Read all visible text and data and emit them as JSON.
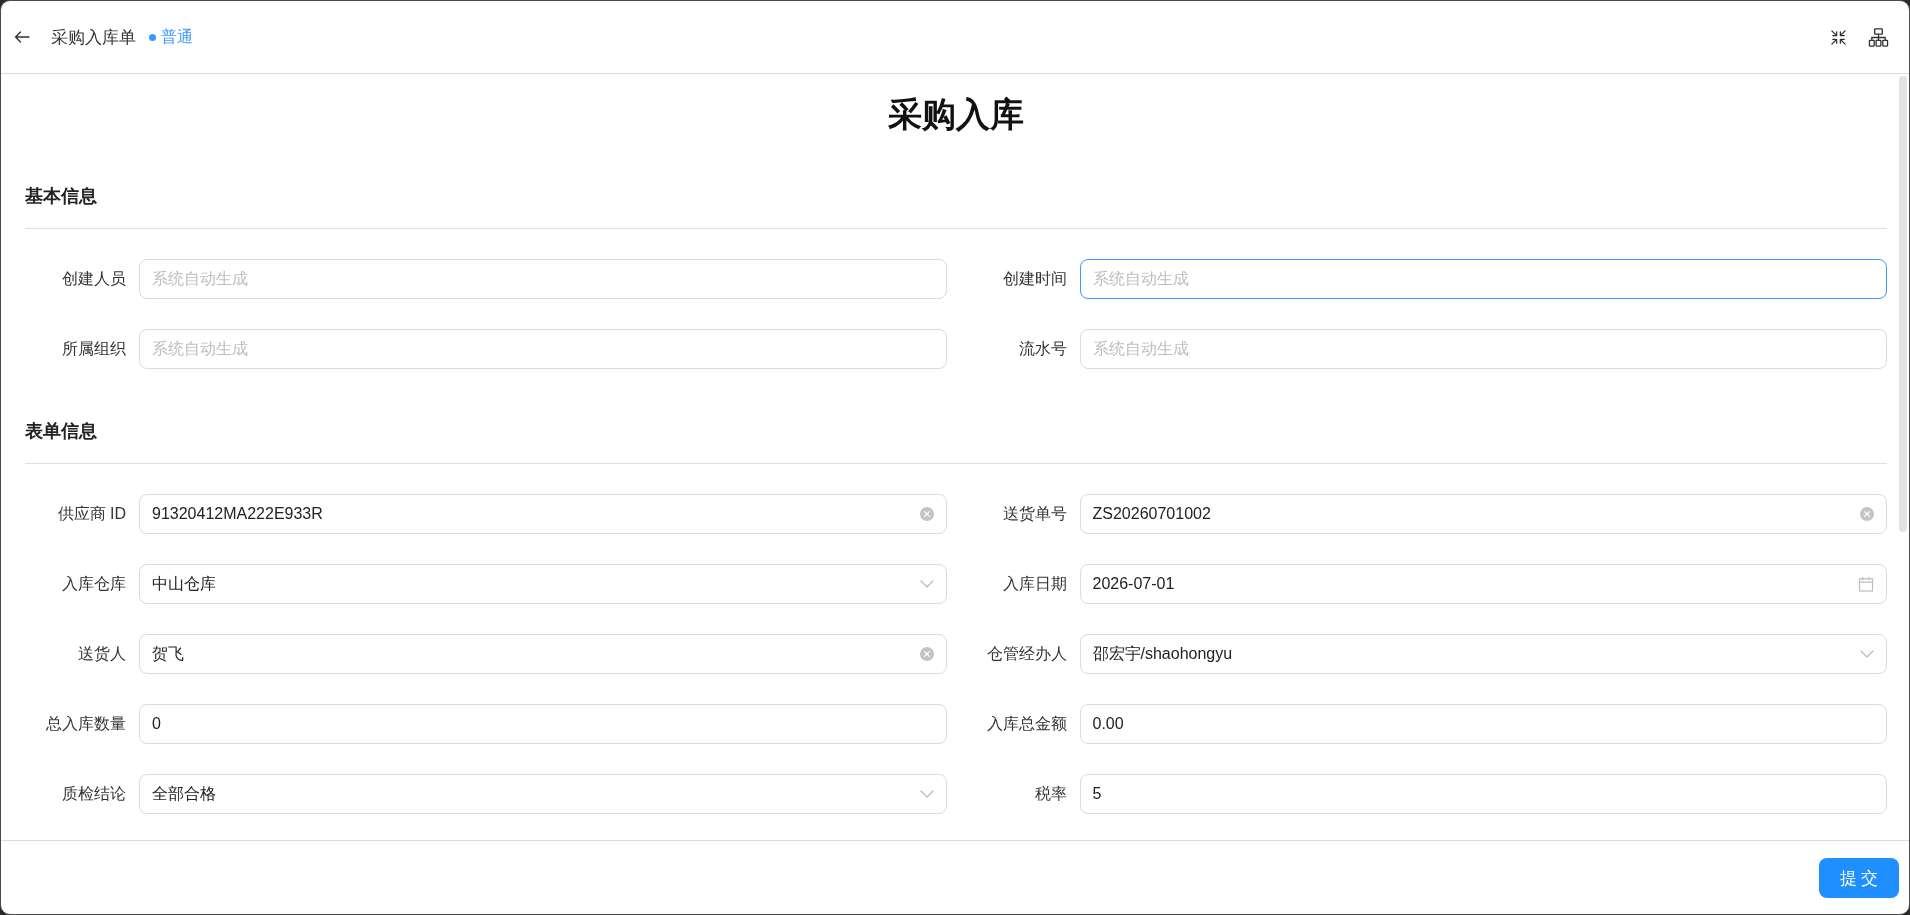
{
  "header": {
    "title": "采购入库单",
    "status": "普通"
  },
  "form_title": "采购入库",
  "sections": [
    {
      "title": "基本信息",
      "fields": [
        {
          "label": "创建人员",
          "kind": "input",
          "placeholder": "系统自动生成",
          "focused": false
        },
        {
          "label": "创建时间",
          "kind": "input",
          "placeholder": "系统自动生成",
          "focused": true
        },
        {
          "label": "所属组织",
          "kind": "input",
          "placeholder": "系统自动生成",
          "focused": false
        },
        {
          "label": "流水号",
          "kind": "input",
          "placeholder": "系统自动生成",
          "focused": false
        }
      ]
    },
    {
      "title": "表单信息",
      "fields": [
        {
          "label": "供应商 ID",
          "kind": "clearable",
          "value": "91320412MA222E933R",
          "focused": false
        },
        {
          "label": "送货单号",
          "kind": "clearable",
          "value": "ZS20260701002",
          "focused": false
        },
        {
          "label": "入库仓库",
          "kind": "select",
          "value": "中山仓库",
          "focused": false
        },
        {
          "label": "入库日期",
          "kind": "date",
          "value": "2026-07-01",
          "focused": false
        },
        {
          "label": "送货人",
          "kind": "clearable",
          "value": "贺飞",
          "focused": false
        },
        {
          "label": "仓管经办人",
          "kind": "select",
          "value": "邵宏宇/shaohongyu",
          "focused": false
        },
        {
          "label": "总入库数量",
          "kind": "input",
          "value": "0",
          "focused": false
        },
        {
          "label": "入库总金额",
          "kind": "input",
          "value": "0.00",
          "focused": false
        },
        {
          "label": "质检结论",
          "kind": "select",
          "value": "全部合格",
          "focused": false
        },
        {
          "label": "税率",
          "kind": "input",
          "value": "5",
          "focused": false
        }
      ]
    }
  ],
  "footer": {
    "submit": "提 交"
  }
}
